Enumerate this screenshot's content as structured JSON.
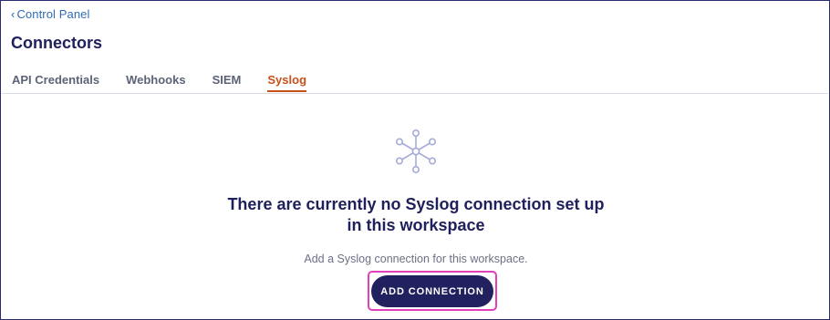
{
  "header": {
    "back_link": "Control Panel",
    "title": "Connectors"
  },
  "tabs": [
    {
      "label": "API Credentials",
      "active": false
    },
    {
      "label": "Webhooks",
      "active": false
    },
    {
      "label": "SIEM",
      "active": false
    },
    {
      "label": "Syslog",
      "active": true
    }
  ],
  "empty_state": {
    "icon": "network-hub-icon",
    "heading": "There are currently no Syslog connection set up in this workspace",
    "subtext": "Add a Syslog connection for this workspace.",
    "button_label": "ADD CONNECTION"
  },
  "colors": {
    "primary": "#222160",
    "active_tab": "#c8501a",
    "link": "#2f6cb5",
    "highlight": "#e040b8"
  }
}
